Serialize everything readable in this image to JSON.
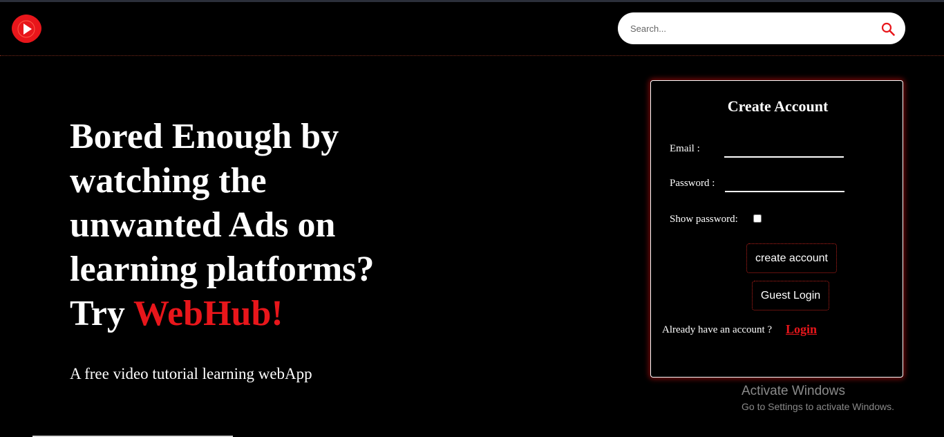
{
  "header": {
    "logo_icon": "play-logo-icon",
    "search": {
      "placeholder": "Search...",
      "value": "",
      "icon": "search-icon"
    }
  },
  "hero": {
    "headline_lines": [
      "Bored Enough by",
      "watching the",
      "unwanted Ads on",
      "learning platforms?"
    ],
    "headline_try": "Try ",
    "brand": "WebHub!",
    "tagline": "A free video tutorial learning webApp"
  },
  "signup_card": {
    "title": "Create Account",
    "email_label": "Email :",
    "email_value": "",
    "password_label": "Password :",
    "password_value": "",
    "show_password_label": "Show password:",
    "show_password_checked": false,
    "create_button": "create account",
    "guest_button": "Guest Login",
    "already_text": "Already have an account ?",
    "login_link": "Login"
  },
  "windows_watermark": {
    "title": "Activate Windows",
    "subtitle": "Go to Settings to activate Windows."
  },
  "colors": {
    "background": "#000000",
    "accent_red": "#e8161b",
    "text": "#ffffff"
  }
}
